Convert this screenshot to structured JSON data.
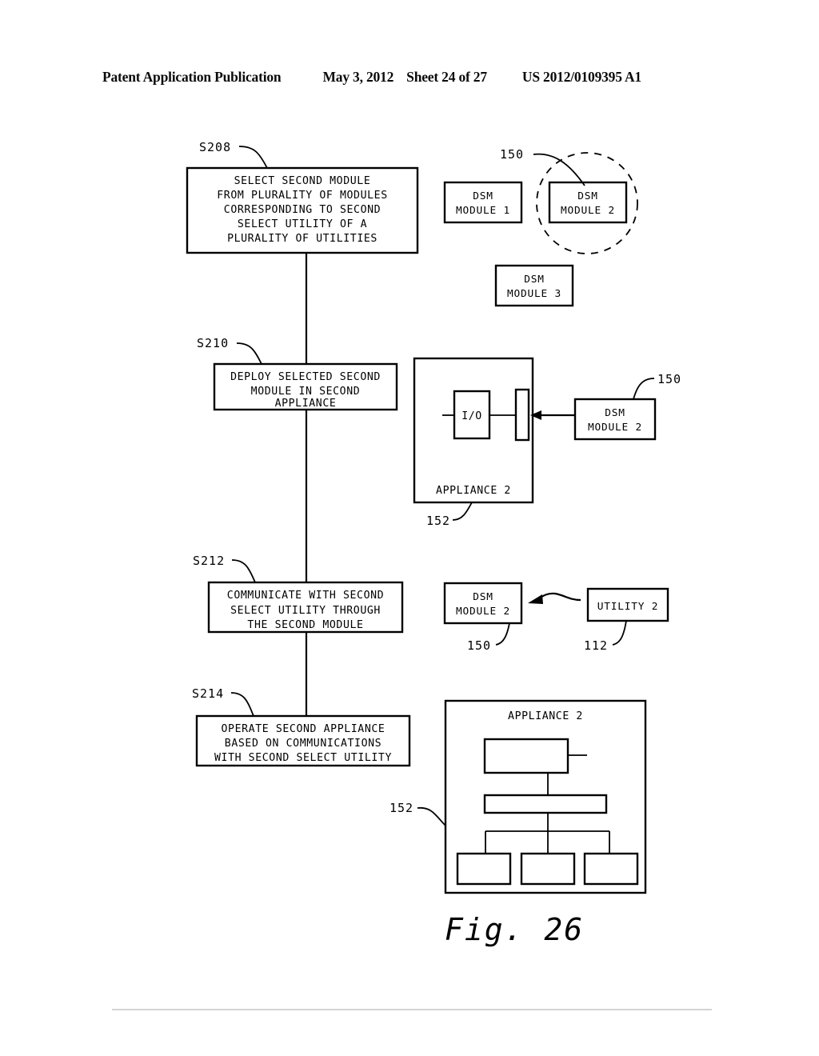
{
  "header": {
    "title": "Patent Application Publication",
    "date": "May 3, 2012",
    "sheet": "Sheet 24 of 27",
    "publication_number": "US 2012/0109395 A1"
  },
  "figure": {
    "caption": "Fig. 26"
  },
  "flow_steps": [
    {
      "ref": "S208",
      "lines": [
        "SELECT SECOND MODULE",
        "FROM PLURALITY OF MODULES",
        "CORRESPONDING TO SECOND",
        "SELECT UTILITY OF A",
        "PLURALITY OF UTILITIES"
      ]
    },
    {
      "ref": "S210",
      "lines": [
        "DEPLOY SELECTED SECOND",
        "MODULE IN SECOND",
        "APPLIANCE"
      ]
    },
    {
      "ref": "S212",
      "lines": [
        "COMMUNICATE WITH SECOND",
        "SELECT UTILITY THROUGH",
        "THE SECOND MODULE"
      ]
    },
    {
      "ref": "S214",
      "lines": [
        "OPERATE SECOND APPLIANCE",
        "BASED ON COMMUNICATIONS",
        "WITH SECOND SELECT UTILITY"
      ]
    }
  ],
  "module_bank": {
    "ref_label": "150",
    "modules": [
      {
        "line1": "DSM",
        "line2": "MODULE 1"
      },
      {
        "line1": "DSM",
        "line2": "MODULE 2"
      },
      {
        "line1": "DSM",
        "line2": "MODULE 3"
      }
    ],
    "highlighted_module": "DSM MODULE 2"
  },
  "deploy_scene": {
    "appliance_label": "APPLIANCE 2",
    "appliance_ref": "152",
    "io_label": "I/O",
    "module": {
      "line1": "DSM",
      "line2": "MODULE 2"
    },
    "module_ref": "150"
  },
  "communicate_scene": {
    "module": {
      "line1": "DSM",
      "line2": "MODULE 2"
    },
    "module_ref": "150",
    "utility_label": "UTILITY 2",
    "utility_ref": "112"
  },
  "operate_scene": {
    "appliance_label": "APPLIANCE 2",
    "appliance_ref": "152"
  },
  "colors": {
    "ink": "#000000",
    "paper": "#ffffff",
    "footer_rule": "#b9b9b9"
  }
}
